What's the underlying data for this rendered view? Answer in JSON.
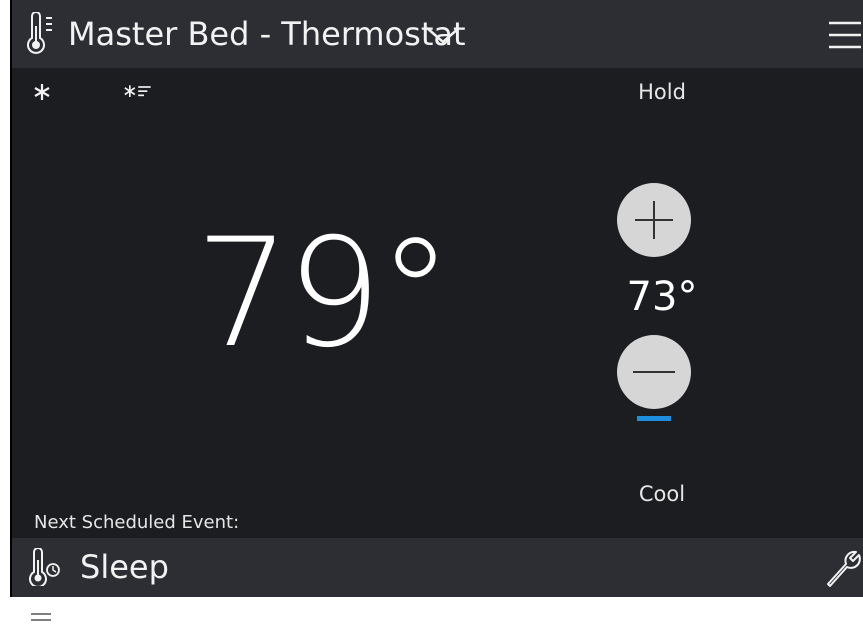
{
  "header": {
    "title": "Master Bed - Thermostat",
    "icons": [
      "thermometer-icon",
      "chevron-down-icon",
      "hamburger-menu-icon"
    ]
  },
  "status_bar": {
    "icons": [
      "snowflake-icon",
      "fan-icon"
    ],
    "hold_label": "Hold"
  },
  "main": {
    "current_temperature": "79°",
    "setpoint": "73°",
    "increase_icon": "plus-icon",
    "decrease_icon": "minus-icon",
    "mode_label": "Cool"
  },
  "schedule": {
    "label": "Next Scheduled Event:",
    "event_name": "Sleep",
    "icons": [
      "thermometer-schedule-icon",
      "wrench-icon"
    ]
  },
  "bottom": {
    "icons": [
      "drag-handle-icon"
    ]
  },
  "colors": {
    "background": "#1c1d21",
    "header_background": "#2c2e33",
    "button_fill": "#d6d6d6",
    "accent_cool": "#1e8fe0",
    "text": "#ffffff"
  }
}
